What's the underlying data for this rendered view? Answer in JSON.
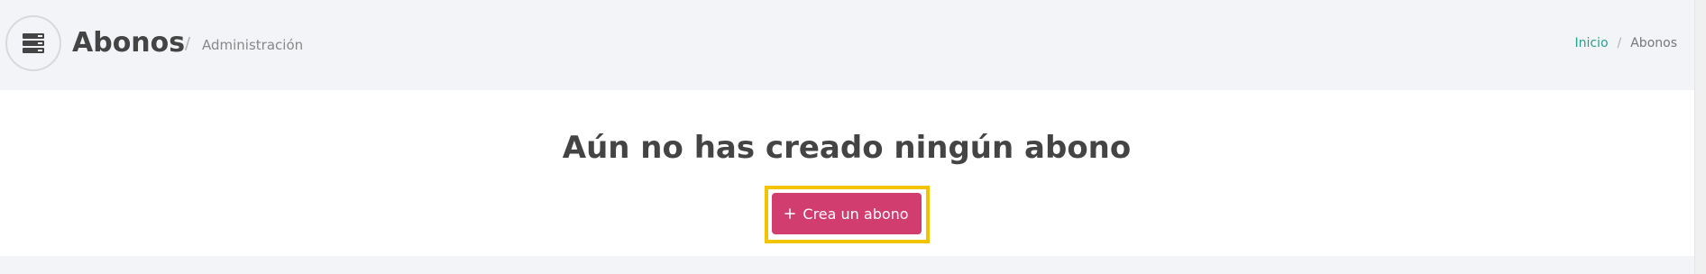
{
  "header": {
    "icon": "server-stack-icon",
    "title": "Abonos",
    "separator": "/",
    "subtitle": "Administración"
  },
  "breadcrumb": {
    "home": "Inicio",
    "separator": "/",
    "current": "Abonos"
  },
  "main": {
    "empty_message": "Aún no has creado ningún abono",
    "create_button": {
      "icon": "plus",
      "label": "Crea un abono"
    }
  },
  "colors": {
    "brand": "#d13d6e",
    "link": "#2a9e8a",
    "highlight": "#f2c400"
  }
}
